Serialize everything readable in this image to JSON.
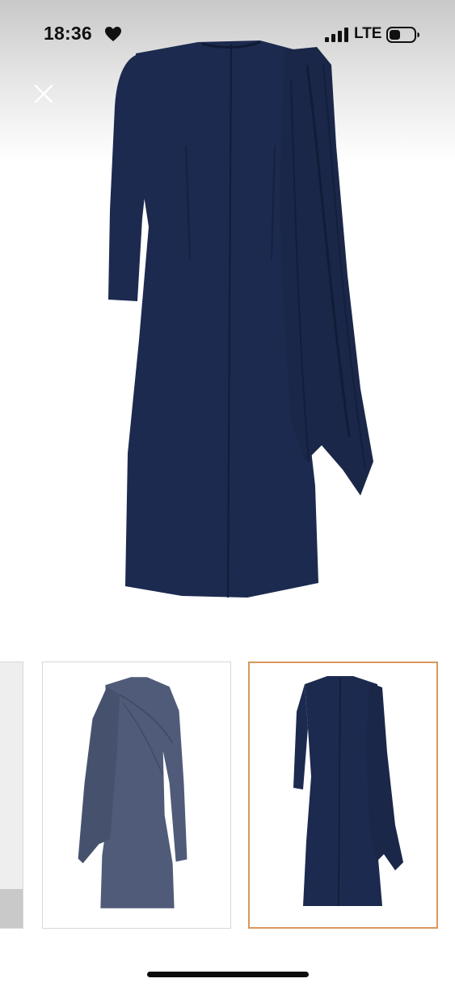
{
  "status_bar": {
    "time": "18:36",
    "network": "LTE",
    "icons": [
      "heart-icon",
      "signal-icon",
      "battery-icon"
    ]
  },
  "viewer": {
    "close_icon": "close-icon",
    "main_image": "dress-back-navy",
    "dress_color": "#1c2a4f",
    "dress_shadow_color": "#121c38",
    "thumbnails": [
      {
        "id": "thumb-partial",
        "selected": false
      },
      {
        "id": "thumb-front",
        "selected": false,
        "color": "#4f5b78"
      },
      {
        "id": "thumb-back",
        "selected": true,
        "color": "#1c2a4f"
      }
    ],
    "selected_border_color": "#d9985c"
  }
}
